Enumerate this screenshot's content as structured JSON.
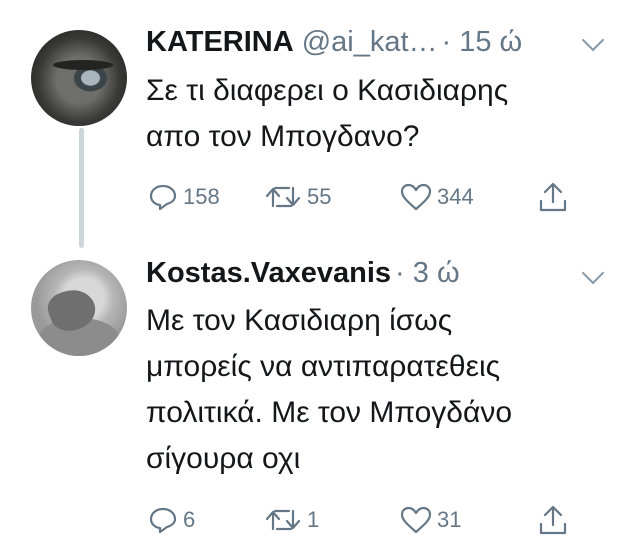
{
  "thread": [
    {
      "name": "KATERINA",
      "handle": "@ai_kat…",
      "time": "· 15 ώ",
      "text": "Σε τι διαφερει ο Κασιδιαρης\nαπο τον Μπογδανο?",
      "replies": "158",
      "retweets": "55",
      "likes": "344"
    },
    {
      "name": "Kostas.Vaxevanis",
      "time": "· 3 ώ",
      "text": "Με τον Κασιδιαρη ίσως\nμπορείς να αντιπαρατεθεις\nπολιτικά. Με τον Μπογδάνο\nσίγουρα οχι",
      "replies": "6",
      "retweets": "1",
      "likes": "31"
    }
  ],
  "colors": {
    "text": "#14171a",
    "secondary": "#657786",
    "thread_line": "#ccd6dd"
  },
  "icons": [
    "reply-icon",
    "retweet-icon",
    "like-icon",
    "share-icon",
    "chevron-down-icon"
  ]
}
